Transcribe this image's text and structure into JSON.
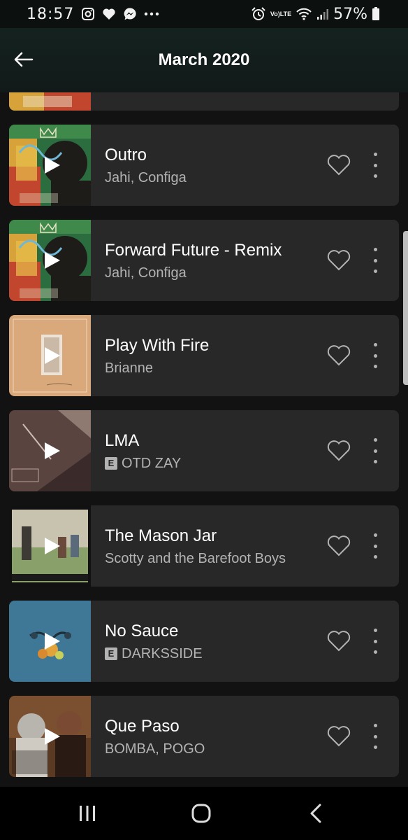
{
  "status_bar": {
    "time": "18:57",
    "battery": "57%",
    "network": "LTE",
    "icons": [
      "instagram-icon",
      "heart-icon",
      "messenger-icon",
      "more-notifications-icon",
      "alarm-icon",
      "volte-icon",
      "wifi-icon",
      "signal-icon",
      "battery-icon"
    ]
  },
  "header": {
    "title": "March 2020",
    "back_icon": "arrow-left-icon"
  },
  "tracks": [
    {
      "title": "",
      "artist": "",
      "explicit": false,
      "art": "jahi-configa"
    },
    {
      "title": "Outro",
      "artist": "Jahi, Configa",
      "explicit": false,
      "art": "jahi-configa"
    },
    {
      "title": "Forward Future - Remix",
      "artist": "Jahi, Configa",
      "explicit": false,
      "art": "jahi-configa"
    },
    {
      "title": "Play With Fire",
      "artist": "Brianne",
      "explicit": false,
      "art": "play-with-fire"
    },
    {
      "title": "LMA",
      "artist": "OTD ZAY",
      "explicit": true,
      "art": "lma"
    },
    {
      "title": "The Mason Jar",
      "artist": "Scotty and the Barefoot Boys",
      "explicit": false,
      "art": "mason-jar"
    },
    {
      "title": "No Sauce",
      "artist": "DARKSSIDE",
      "explicit": true,
      "art": "no-sauce"
    },
    {
      "title": "Que Paso",
      "artist": "BOMBA, POGO",
      "explicit": false,
      "art": "que-paso"
    }
  ],
  "explicit_label": "E",
  "colors": {
    "background": "#121212",
    "card": "#282828",
    "secondary_text": "#b3b3b3",
    "header": "#14221f"
  }
}
